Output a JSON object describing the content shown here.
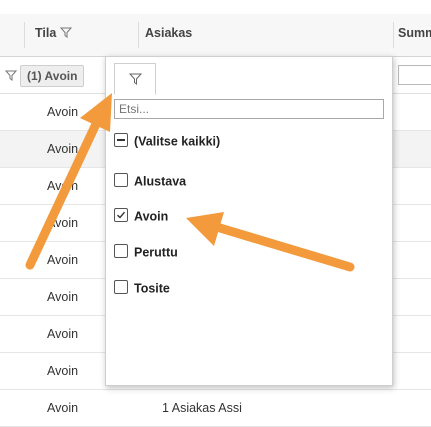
{
  "colors": {
    "arrow": "#f39a3d",
    "header_bg": "#f7f7f7",
    "alt_row": "#f3f3f3"
  },
  "header": {
    "tila_label": "Tila",
    "asiakas_label": "Asiakas",
    "summa_label": "Summ"
  },
  "filter_row": {
    "tila_chip": "(1) Avoin"
  },
  "rows": [
    {
      "tila": "Avoin",
      "asiakas": ""
    },
    {
      "tila": "Avoin",
      "asiakas": ""
    },
    {
      "tila": "Avoin",
      "asiakas": ""
    },
    {
      "tila": "Avoin",
      "asiakas": ""
    },
    {
      "tila": "Avoin",
      "asiakas": ""
    },
    {
      "tila": "Avoin",
      "asiakas": ""
    },
    {
      "tila": "Avoin",
      "asiakas": ""
    },
    {
      "tila": "Avoin",
      "asiakas": ""
    },
    {
      "tila": "Avoin",
      "asiakas": "1 Asiakas Assi"
    }
  ],
  "popup": {
    "search_placeholder": "Etsi...",
    "select_all": "(Valitse kaikki)",
    "options": [
      {
        "label": "Alustava",
        "checked": false
      },
      {
        "label": "Avoin",
        "checked": true
      },
      {
        "label": "Peruttu",
        "checked": false
      },
      {
        "label": "Tosite",
        "checked": false
      }
    ]
  }
}
